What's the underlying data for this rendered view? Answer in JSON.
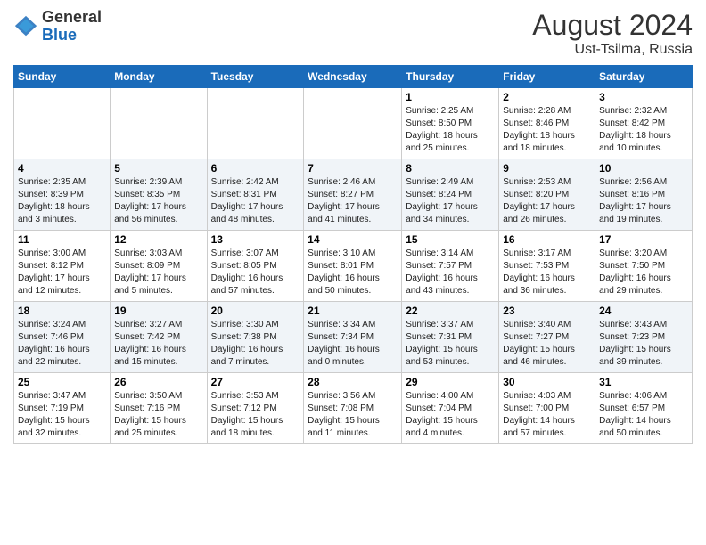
{
  "header": {
    "logo_general": "General",
    "logo_blue": "Blue",
    "month_year": "August 2024",
    "location": "Ust-Tsilma, Russia"
  },
  "days_of_week": [
    "Sunday",
    "Monday",
    "Tuesday",
    "Wednesday",
    "Thursday",
    "Friday",
    "Saturday"
  ],
  "weeks": [
    [
      {
        "day": "",
        "info": ""
      },
      {
        "day": "",
        "info": ""
      },
      {
        "day": "",
        "info": ""
      },
      {
        "day": "",
        "info": ""
      },
      {
        "day": "1",
        "info": "Sunrise: 2:25 AM\nSunset: 8:50 PM\nDaylight: 18 hours\nand 25 minutes."
      },
      {
        "day": "2",
        "info": "Sunrise: 2:28 AM\nSunset: 8:46 PM\nDaylight: 18 hours\nand 18 minutes."
      },
      {
        "day": "3",
        "info": "Sunrise: 2:32 AM\nSunset: 8:42 PM\nDaylight: 18 hours\nand 10 minutes."
      }
    ],
    [
      {
        "day": "4",
        "info": "Sunrise: 2:35 AM\nSunset: 8:39 PM\nDaylight: 18 hours\nand 3 minutes."
      },
      {
        "day": "5",
        "info": "Sunrise: 2:39 AM\nSunset: 8:35 PM\nDaylight: 17 hours\nand 56 minutes."
      },
      {
        "day": "6",
        "info": "Sunrise: 2:42 AM\nSunset: 8:31 PM\nDaylight: 17 hours\nand 48 minutes."
      },
      {
        "day": "7",
        "info": "Sunrise: 2:46 AM\nSunset: 8:27 PM\nDaylight: 17 hours\nand 41 minutes."
      },
      {
        "day": "8",
        "info": "Sunrise: 2:49 AM\nSunset: 8:24 PM\nDaylight: 17 hours\nand 34 minutes."
      },
      {
        "day": "9",
        "info": "Sunrise: 2:53 AM\nSunset: 8:20 PM\nDaylight: 17 hours\nand 26 minutes."
      },
      {
        "day": "10",
        "info": "Sunrise: 2:56 AM\nSunset: 8:16 PM\nDaylight: 17 hours\nand 19 minutes."
      }
    ],
    [
      {
        "day": "11",
        "info": "Sunrise: 3:00 AM\nSunset: 8:12 PM\nDaylight: 17 hours\nand 12 minutes."
      },
      {
        "day": "12",
        "info": "Sunrise: 3:03 AM\nSunset: 8:09 PM\nDaylight: 17 hours\nand 5 minutes."
      },
      {
        "day": "13",
        "info": "Sunrise: 3:07 AM\nSunset: 8:05 PM\nDaylight: 16 hours\nand 57 minutes."
      },
      {
        "day": "14",
        "info": "Sunrise: 3:10 AM\nSunset: 8:01 PM\nDaylight: 16 hours\nand 50 minutes."
      },
      {
        "day": "15",
        "info": "Sunrise: 3:14 AM\nSunset: 7:57 PM\nDaylight: 16 hours\nand 43 minutes."
      },
      {
        "day": "16",
        "info": "Sunrise: 3:17 AM\nSunset: 7:53 PM\nDaylight: 16 hours\nand 36 minutes."
      },
      {
        "day": "17",
        "info": "Sunrise: 3:20 AM\nSunset: 7:50 PM\nDaylight: 16 hours\nand 29 minutes."
      }
    ],
    [
      {
        "day": "18",
        "info": "Sunrise: 3:24 AM\nSunset: 7:46 PM\nDaylight: 16 hours\nand 22 minutes."
      },
      {
        "day": "19",
        "info": "Sunrise: 3:27 AM\nSunset: 7:42 PM\nDaylight: 16 hours\nand 15 minutes."
      },
      {
        "day": "20",
        "info": "Sunrise: 3:30 AM\nSunset: 7:38 PM\nDaylight: 16 hours\nand 7 minutes."
      },
      {
        "day": "21",
        "info": "Sunrise: 3:34 AM\nSunset: 7:34 PM\nDaylight: 16 hours\nand 0 minutes."
      },
      {
        "day": "22",
        "info": "Sunrise: 3:37 AM\nSunset: 7:31 PM\nDaylight: 15 hours\nand 53 minutes."
      },
      {
        "day": "23",
        "info": "Sunrise: 3:40 AM\nSunset: 7:27 PM\nDaylight: 15 hours\nand 46 minutes."
      },
      {
        "day": "24",
        "info": "Sunrise: 3:43 AM\nSunset: 7:23 PM\nDaylight: 15 hours\nand 39 minutes."
      }
    ],
    [
      {
        "day": "25",
        "info": "Sunrise: 3:47 AM\nSunset: 7:19 PM\nDaylight: 15 hours\nand 32 minutes."
      },
      {
        "day": "26",
        "info": "Sunrise: 3:50 AM\nSunset: 7:16 PM\nDaylight: 15 hours\nand 25 minutes."
      },
      {
        "day": "27",
        "info": "Sunrise: 3:53 AM\nSunset: 7:12 PM\nDaylight: 15 hours\nand 18 minutes."
      },
      {
        "day": "28",
        "info": "Sunrise: 3:56 AM\nSunset: 7:08 PM\nDaylight: 15 hours\nand 11 minutes."
      },
      {
        "day": "29",
        "info": "Sunrise: 4:00 AM\nSunset: 7:04 PM\nDaylight: 15 hours\nand 4 minutes."
      },
      {
        "day": "30",
        "info": "Sunrise: 4:03 AM\nSunset: 7:00 PM\nDaylight: 14 hours\nand 57 minutes."
      },
      {
        "day": "31",
        "info": "Sunrise: 4:06 AM\nSunset: 6:57 PM\nDaylight: 14 hours\nand 50 minutes."
      }
    ]
  ]
}
